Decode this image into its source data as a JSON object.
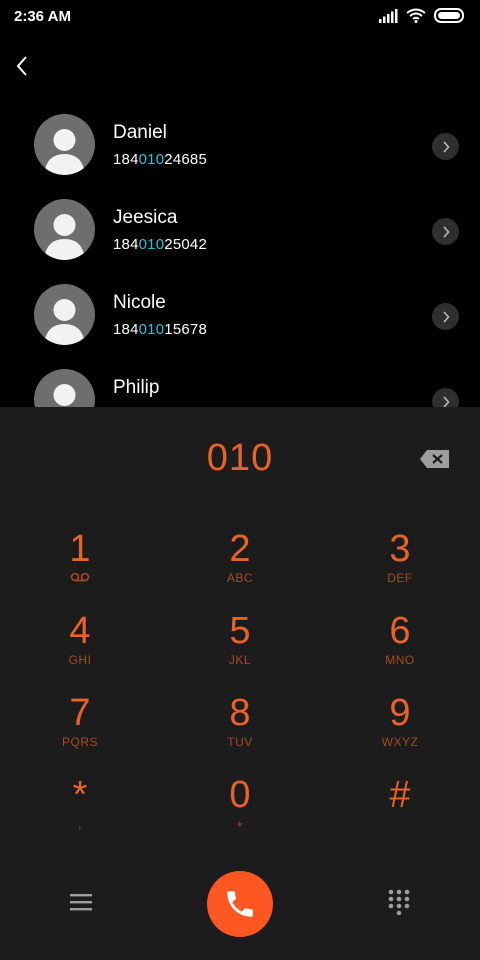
{
  "status_bar": {
    "time": "2:36 AM",
    "icons": [
      "signal-icon",
      "wifi-icon",
      "battery-icon"
    ]
  },
  "colors": {
    "accent": "#e8632a",
    "call_button": "#ff5722",
    "match_highlight": "#26c6da",
    "dialpad_bg": "#1c1c1c"
  },
  "contacts": [
    {
      "name": "Daniel",
      "number_prefix": "184",
      "number_match": "010",
      "number_suffix": "24685"
    },
    {
      "name": "Jeesica",
      "number_prefix": "184",
      "number_match": "010",
      "number_suffix": "25042"
    },
    {
      "name": "Nicole",
      "number_prefix": "184",
      "number_match": "010",
      "number_suffix": "15678"
    },
    {
      "name": "Philip",
      "number_prefix": "",
      "number_match": "",
      "number_suffix": ""
    }
  ],
  "dialer": {
    "display": "010",
    "keys": [
      {
        "digit": "1",
        "letters": ""
      },
      {
        "digit": "2",
        "letters": "ABC"
      },
      {
        "digit": "3",
        "letters": "DEF"
      },
      {
        "digit": "4",
        "letters": "GHI"
      },
      {
        "digit": "5",
        "letters": "JKL"
      },
      {
        "digit": "6",
        "letters": "MNO"
      },
      {
        "digit": "7",
        "letters": "PQRS"
      },
      {
        "digit": "8",
        "letters": "TUV"
      },
      {
        "digit": "9",
        "letters": "WXYZ"
      },
      {
        "digit": "*",
        "letters": ","
      },
      {
        "digit": "0",
        "letters": "+"
      },
      {
        "digit": "#",
        "letters": ""
      }
    ]
  }
}
